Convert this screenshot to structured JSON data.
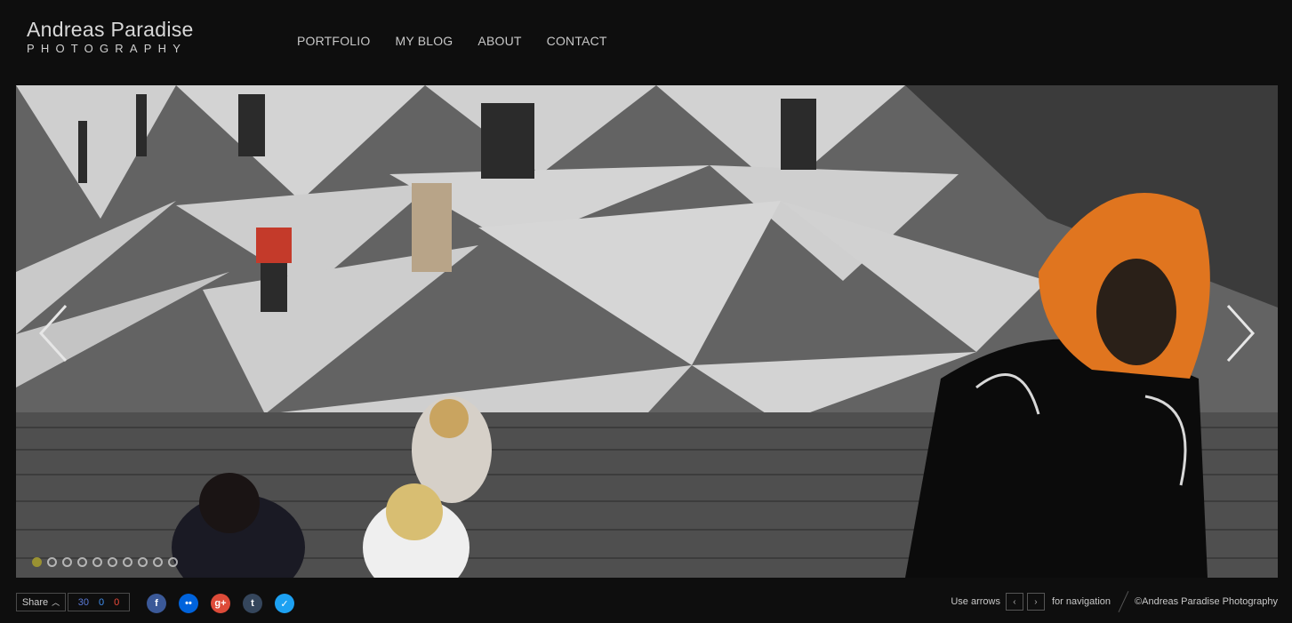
{
  "logo": {
    "name": "Andreas Paradise",
    "sub": "PHOTOGRAPHY"
  },
  "nav": {
    "items": [
      "PORTFOLIO",
      "MY BLOG",
      "ABOUT",
      "CONTACT"
    ]
  },
  "slider": {
    "dot_count": 10,
    "active_index": 0
  },
  "footer": {
    "share_label": "Share",
    "counts": [
      "30",
      "0",
      "0"
    ],
    "socials": [
      {
        "icon": "facebook-icon",
        "glyph": "f",
        "color": "#3b5998"
      },
      {
        "icon": "flickr-icon",
        "glyph": "••",
        "color": "#0063dc"
      },
      {
        "icon": "google-plus-icon",
        "glyph": "g+",
        "color": "#dd4b39"
      },
      {
        "icon": "tumblr-icon",
        "glyph": "t",
        "color": "#35465c"
      },
      {
        "icon": "twitter-icon",
        "glyph": "✓",
        "color": "#1da1f2"
      }
    ],
    "hint_pre": "Use arrows",
    "hint_post": "for navigation",
    "copyright": "©Andreas Paradise Photography"
  }
}
